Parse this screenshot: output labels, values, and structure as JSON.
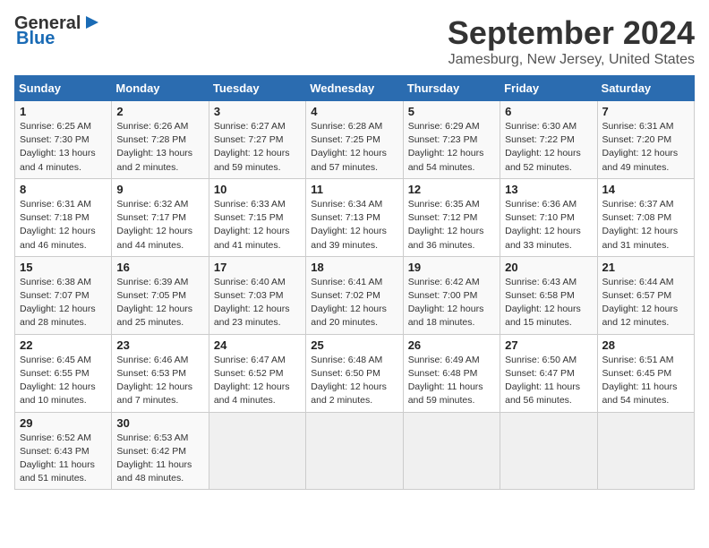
{
  "header": {
    "logo_line1": "General",
    "logo_line2": "Blue",
    "month": "September 2024",
    "location": "Jamesburg, New Jersey, United States"
  },
  "days_of_week": [
    "Sunday",
    "Monday",
    "Tuesday",
    "Wednesday",
    "Thursday",
    "Friday",
    "Saturday"
  ],
  "weeks": [
    [
      {
        "day": "1",
        "info": "Sunrise: 6:25 AM\nSunset: 7:30 PM\nDaylight: 13 hours\nand 4 minutes."
      },
      {
        "day": "2",
        "info": "Sunrise: 6:26 AM\nSunset: 7:28 PM\nDaylight: 13 hours\nand 2 minutes."
      },
      {
        "day": "3",
        "info": "Sunrise: 6:27 AM\nSunset: 7:27 PM\nDaylight: 12 hours\nand 59 minutes."
      },
      {
        "day": "4",
        "info": "Sunrise: 6:28 AM\nSunset: 7:25 PM\nDaylight: 12 hours\nand 57 minutes."
      },
      {
        "day": "5",
        "info": "Sunrise: 6:29 AM\nSunset: 7:23 PM\nDaylight: 12 hours\nand 54 minutes."
      },
      {
        "day": "6",
        "info": "Sunrise: 6:30 AM\nSunset: 7:22 PM\nDaylight: 12 hours\nand 52 minutes."
      },
      {
        "day": "7",
        "info": "Sunrise: 6:31 AM\nSunset: 7:20 PM\nDaylight: 12 hours\nand 49 minutes."
      }
    ],
    [
      {
        "day": "8",
        "info": "Sunrise: 6:31 AM\nSunset: 7:18 PM\nDaylight: 12 hours\nand 46 minutes."
      },
      {
        "day": "9",
        "info": "Sunrise: 6:32 AM\nSunset: 7:17 PM\nDaylight: 12 hours\nand 44 minutes."
      },
      {
        "day": "10",
        "info": "Sunrise: 6:33 AM\nSunset: 7:15 PM\nDaylight: 12 hours\nand 41 minutes."
      },
      {
        "day": "11",
        "info": "Sunrise: 6:34 AM\nSunset: 7:13 PM\nDaylight: 12 hours\nand 39 minutes."
      },
      {
        "day": "12",
        "info": "Sunrise: 6:35 AM\nSunset: 7:12 PM\nDaylight: 12 hours\nand 36 minutes."
      },
      {
        "day": "13",
        "info": "Sunrise: 6:36 AM\nSunset: 7:10 PM\nDaylight: 12 hours\nand 33 minutes."
      },
      {
        "day": "14",
        "info": "Sunrise: 6:37 AM\nSunset: 7:08 PM\nDaylight: 12 hours\nand 31 minutes."
      }
    ],
    [
      {
        "day": "15",
        "info": "Sunrise: 6:38 AM\nSunset: 7:07 PM\nDaylight: 12 hours\nand 28 minutes."
      },
      {
        "day": "16",
        "info": "Sunrise: 6:39 AM\nSunset: 7:05 PM\nDaylight: 12 hours\nand 25 minutes."
      },
      {
        "day": "17",
        "info": "Sunrise: 6:40 AM\nSunset: 7:03 PM\nDaylight: 12 hours\nand 23 minutes."
      },
      {
        "day": "18",
        "info": "Sunrise: 6:41 AM\nSunset: 7:02 PM\nDaylight: 12 hours\nand 20 minutes."
      },
      {
        "day": "19",
        "info": "Sunrise: 6:42 AM\nSunset: 7:00 PM\nDaylight: 12 hours\nand 18 minutes."
      },
      {
        "day": "20",
        "info": "Sunrise: 6:43 AM\nSunset: 6:58 PM\nDaylight: 12 hours\nand 15 minutes."
      },
      {
        "day": "21",
        "info": "Sunrise: 6:44 AM\nSunset: 6:57 PM\nDaylight: 12 hours\nand 12 minutes."
      }
    ],
    [
      {
        "day": "22",
        "info": "Sunrise: 6:45 AM\nSunset: 6:55 PM\nDaylight: 12 hours\nand 10 minutes."
      },
      {
        "day": "23",
        "info": "Sunrise: 6:46 AM\nSunset: 6:53 PM\nDaylight: 12 hours\nand 7 minutes."
      },
      {
        "day": "24",
        "info": "Sunrise: 6:47 AM\nSunset: 6:52 PM\nDaylight: 12 hours\nand 4 minutes."
      },
      {
        "day": "25",
        "info": "Sunrise: 6:48 AM\nSunset: 6:50 PM\nDaylight: 12 hours\nand 2 minutes."
      },
      {
        "day": "26",
        "info": "Sunrise: 6:49 AM\nSunset: 6:48 PM\nDaylight: 11 hours\nand 59 minutes."
      },
      {
        "day": "27",
        "info": "Sunrise: 6:50 AM\nSunset: 6:47 PM\nDaylight: 11 hours\nand 56 minutes."
      },
      {
        "day": "28",
        "info": "Sunrise: 6:51 AM\nSunset: 6:45 PM\nDaylight: 11 hours\nand 54 minutes."
      }
    ],
    [
      {
        "day": "29",
        "info": "Sunrise: 6:52 AM\nSunset: 6:43 PM\nDaylight: 11 hours\nand 51 minutes."
      },
      {
        "day": "30",
        "info": "Sunrise: 6:53 AM\nSunset: 6:42 PM\nDaylight: 11 hours\nand 48 minutes."
      },
      {
        "day": "",
        "info": ""
      },
      {
        "day": "",
        "info": ""
      },
      {
        "day": "",
        "info": ""
      },
      {
        "day": "",
        "info": ""
      },
      {
        "day": "",
        "info": ""
      }
    ]
  ]
}
